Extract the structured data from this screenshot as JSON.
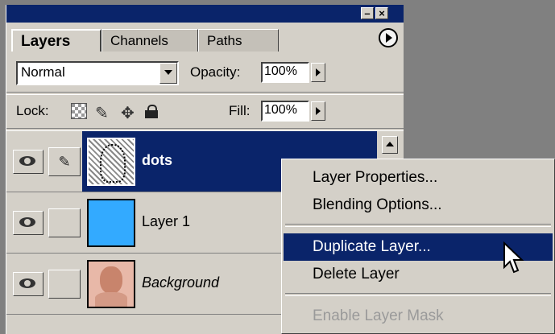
{
  "palette": {
    "tabs": [
      {
        "label": "Layers",
        "active": true
      },
      {
        "label": "Channels",
        "active": false
      },
      {
        "label": "Paths",
        "active": false
      }
    ]
  },
  "blend_mode": "Normal",
  "opacity": {
    "label": "Opacity:",
    "value": "100%"
  },
  "lock": {
    "label": "Lock:"
  },
  "fill": {
    "label": "Fill:",
    "value": "100%"
  },
  "layers": [
    {
      "name": "dots",
      "selected": true
    },
    {
      "name": "Layer 1",
      "selected": false
    },
    {
      "name": "Background",
      "selected": false
    }
  ],
  "context_menu": {
    "items": [
      {
        "label": "Layer Properties...",
        "state": "normal"
      },
      {
        "label": "Blending Options...",
        "state": "normal"
      },
      {
        "label": "Duplicate Layer...",
        "state": "highlighted"
      },
      {
        "label": "Delete Layer",
        "state": "normal"
      },
      {
        "label": "Enable Layer Mask",
        "state": "disabled"
      }
    ]
  },
  "colors": {
    "title_bar": "#0a246a",
    "selection": "#0a246a",
    "layer1_fill": "#33aaff"
  },
  "icons": [
    "minimize-icon",
    "close-icon",
    "palette-menu-icon",
    "lock-transparency-icon",
    "lock-brush-icon",
    "lock-move-icon",
    "lock-all-icon",
    "eye-icon",
    "brush-link-icon",
    "mouse-pointer-icon"
  ]
}
